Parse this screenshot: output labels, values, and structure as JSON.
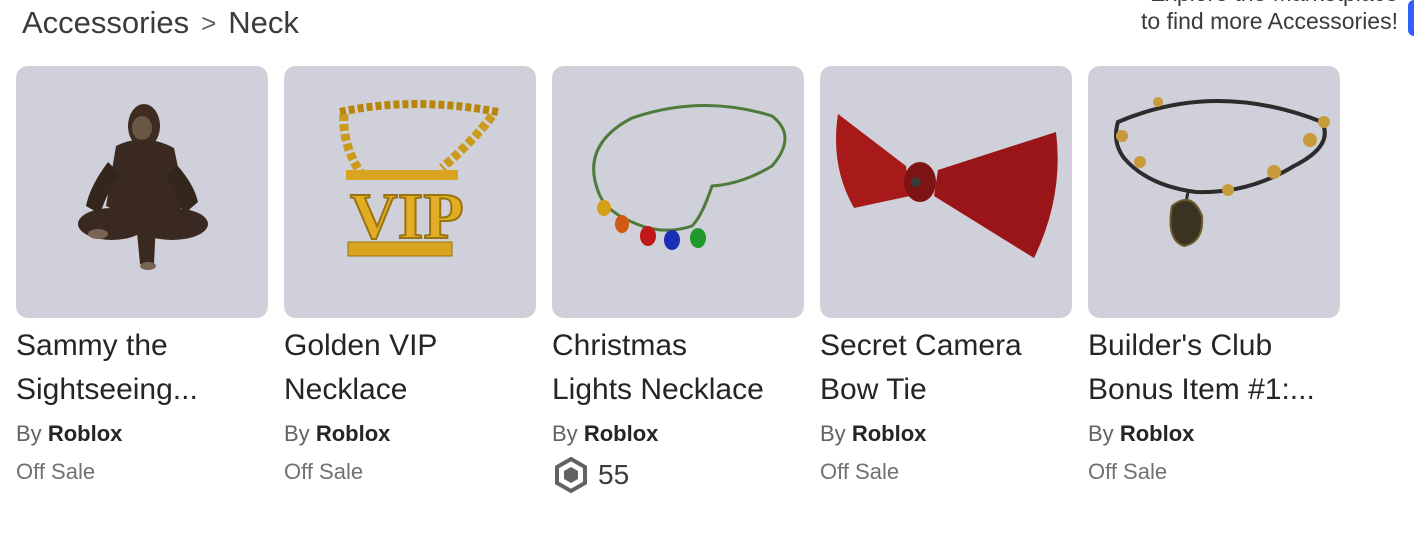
{
  "breadcrumb": {
    "parent": "Accessories",
    "separator": ">",
    "current": "Neck"
  },
  "promo": {
    "line1_partial": "Explore the Marketplace",
    "line2": "to find more Accessories!"
  },
  "colors": {
    "thumb_bg": "#cfd0d9",
    "accent": "#335fff"
  },
  "items": [
    {
      "name_line1": "Sammy the",
      "name_line2": "Sightseeing...",
      "by_prefix": "By",
      "creator": "Roblox",
      "price": "Off Sale",
      "icon": "bigfoot-figure-icon"
    },
    {
      "name_line1": "Golden VIP",
      "name_line2": "Necklace",
      "by_prefix": "By",
      "creator": "Roblox",
      "price": "Off Sale",
      "icon": "vip-chain-icon"
    },
    {
      "name_line1": "Christmas",
      "name_line2": "Lights Necklace",
      "by_prefix": "By",
      "creator": "Roblox",
      "price": "55",
      "currency_icon": "robux-icon",
      "icon": "christmas-lights-icon"
    },
    {
      "name_line1": "Secret Camera",
      "name_line2": "Bow Tie",
      "by_prefix": "By",
      "creator": "Roblox",
      "price": "Off Sale",
      "icon": "bow-tie-icon"
    },
    {
      "name_line1": "Builder's Club",
      "name_line2": "Bonus Item #1:...",
      "by_prefix": "By",
      "creator": "Roblox",
      "price": "Off Sale",
      "icon": "pendant-necklace-icon"
    }
  ]
}
